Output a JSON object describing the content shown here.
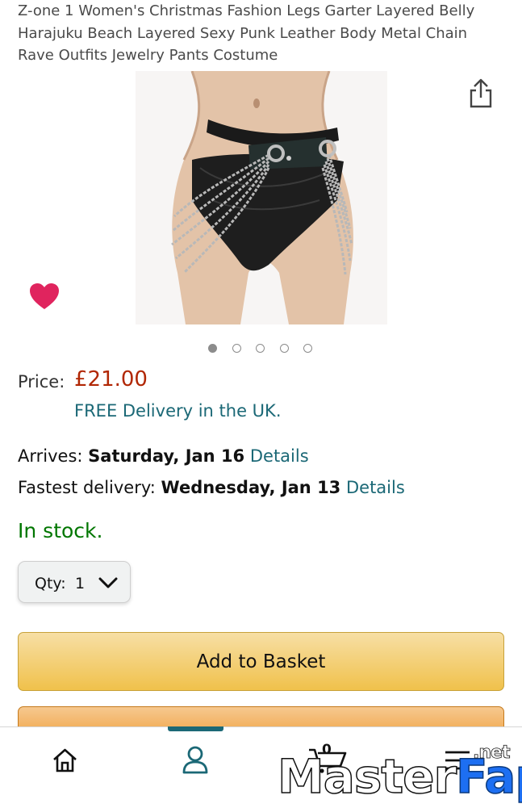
{
  "product": {
    "title": "Z-one 1 Women's Christmas Fashion Legs Garter Layered Belly Harajuku Beach Layered Sexy Punk Leather Body Metal Chain Rave Outfits Jewelry Pants Costume",
    "image_dots": 5,
    "active_dot": 1
  },
  "price": {
    "label": "Price:",
    "value": "£21.00",
    "free_delivery": "FREE Delivery in the UK."
  },
  "delivery": {
    "arrives_label": "Arrives:",
    "arrives_date": "Saturday, Jan 16",
    "arrives_link": "Details",
    "fastest_label": "Fastest delivery:",
    "fastest_date": "Wednesday, Jan 13",
    "fastest_link": "Details"
  },
  "stock": "In stock.",
  "quantity": {
    "label": "Qty:",
    "value": "1"
  },
  "actions": {
    "add_to_basket": "Add to Basket"
  },
  "bottom_nav": {
    "items": [
      "home-icon",
      "account-icon",
      "cart-icon",
      "menu-icon"
    ],
    "active": "account-icon",
    "cart_count": "0"
  },
  "watermark": {
    "part1": "Master",
    "part2": "Fap",
    "suffix": ".net"
  },
  "colors": {
    "price": "#b12704",
    "link": "#1b6876",
    "in_stock": "#007600",
    "add_button": "#f0c14b",
    "buy_button": "#ed9220",
    "heart": "#e0245e"
  }
}
